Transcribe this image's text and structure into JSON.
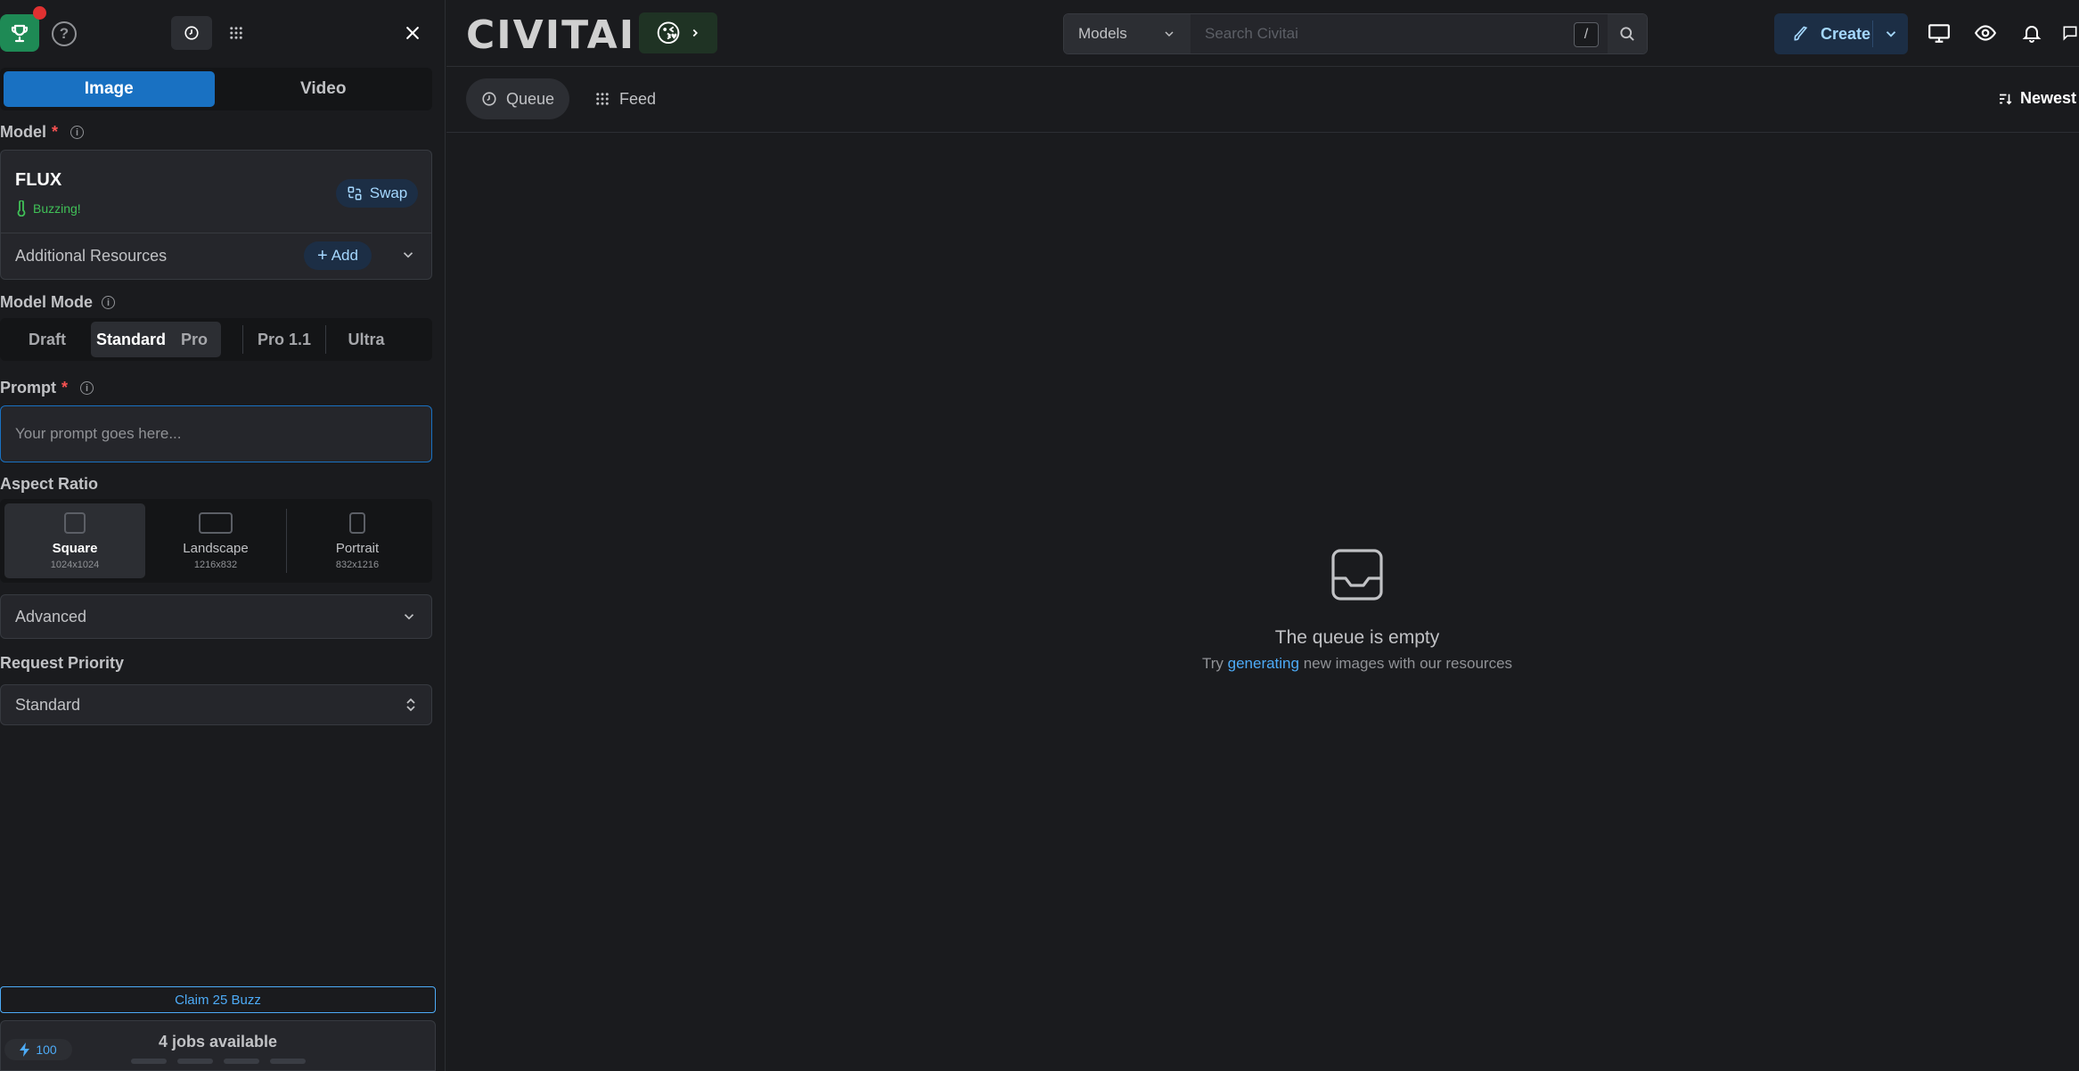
{
  "sidebar": {
    "tabs": [
      {
        "label": "Image",
        "active": true
      },
      {
        "label": "Video",
        "active": false
      }
    ],
    "model_label": "Model",
    "model": {
      "name": "FLUX",
      "status": "Buzzing!",
      "swap_label": "Swap"
    },
    "additional_resources": {
      "label": "Additional Resources",
      "add_label": "Add"
    },
    "model_mode_label": "Model Mode",
    "modes": [
      "Draft",
      "Standard",
      "Pro",
      "Pro 1.1",
      "Ultra"
    ],
    "active_mode": "Standard",
    "prompt_label": "Prompt",
    "prompt_placeholder": "Your prompt goes here...",
    "aspect_ratio_label": "Aspect Ratio",
    "ratios": [
      {
        "name": "Square",
        "dims": "1024x1024",
        "active": true
      },
      {
        "name": "Landscape",
        "dims": "1216x832",
        "active": false
      },
      {
        "name": "Portrait",
        "dims": "832x1216",
        "active": false
      }
    ],
    "advanced_label": "Advanced",
    "priority_label": "Request Priority",
    "priority_value": "Standard",
    "claim_label": "Claim 25 Buzz",
    "buzz_amount": "100",
    "jobs_label": "4 jobs available"
  },
  "header": {
    "logo": "CIVITAI",
    "emoji": "😘",
    "search": {
      "category": "Models",
      "placeholder": "Search Civitai",
      "shortcut": "/"
    },
    "create_label": "Create"
  },
  "main": {
    "queue_label": "Queue",
    "feed_label": "Feed",
    "sort_label": "Newest",
    "empty_title": "The queue is empty",
    "empty_sub_prefix": "Try",
    "empty_sub_link": "generating",
    "empty_sub_suffix": "new images with our resources"
  },
  "colors": {
    "accent": "#1971c2",
    "link": "#4dabf7",
    "success": "#40c057",
    "bg": "#1a1b1e"
  }
}
